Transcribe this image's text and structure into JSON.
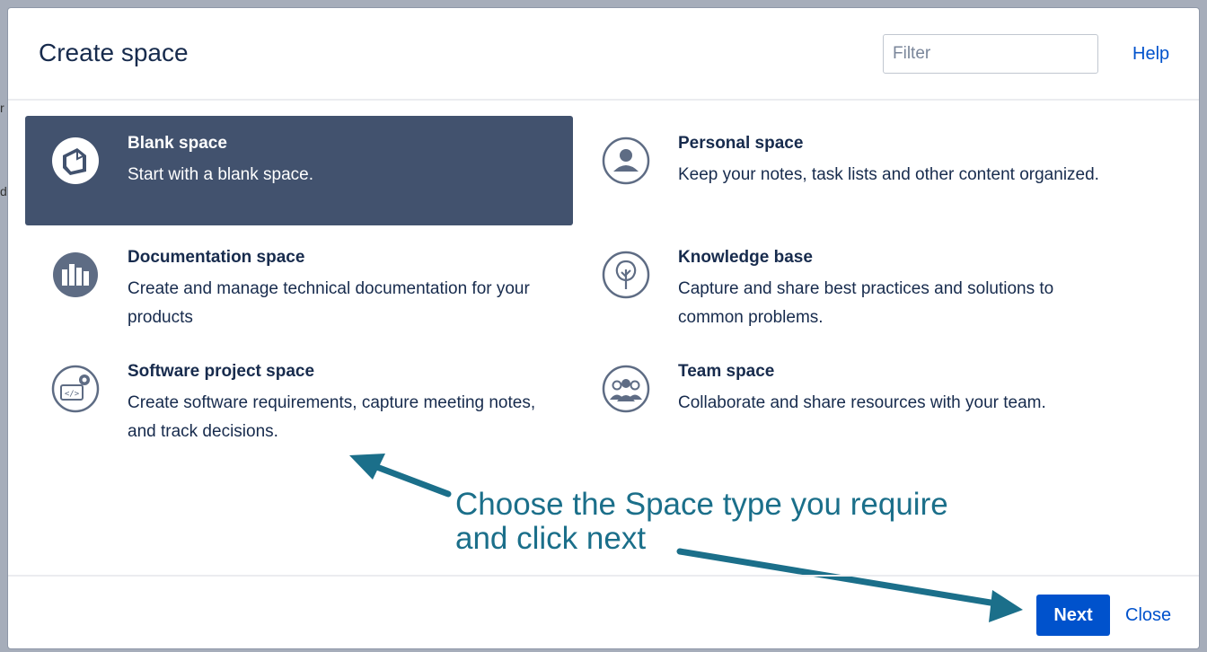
{
  "dialog": {
    "title": "Create space",
    "filter_placeholder": "Filter",
    "help_label": "Help"
  },
  "space_types": [
    {
      "name": "Blank space",
      "description": "Start with a blank space.",
      "icon": "blank-space-icon",
      "selected": true
    },
    {
      "name": "Personal space",
      "description": "Keep your notes, task lists and other content organized.",
      "icon": "personal-space-icon",
      "selected": false
    },
    {
      "name": "Documentation space",
      "description": "Create and manage technical documentation for your products",
      "icon": "documentation-space-icon",
      "selected": false
    },
    {
      "name": "Knowledge base",
      "description": "Capture and share best practices and solutions to common problems.",
      "icon": "knowledge-base-icon",
      "selected": false
    },
    {
      "name": "Software project space",
      "description": "Create software requirements, capture meeting notes, and track decisions.",
      "icon": "software-project-space-icon",
      "selected": false
    },
    {
      "name": "Team space",
      "description": "Collaborate and share resources with your team.",
      "icon": "team-space-icon",
      "selected": false
    }
  ],
  "annotation": {
    "line1": "Choose the Space type you require",
    "line2": "and click next"
  },
  "footer": {
    "next_label": "Next",
    "close_label": "Close"
  },
  "background": {
    "fragment1": "r",
    "fragment2": "d"
  },
  "colors": {
    "selected_card": "#42526e",
    "primary": "#0052cc",
    "annotation": "#1b6f8a"
  }
}
